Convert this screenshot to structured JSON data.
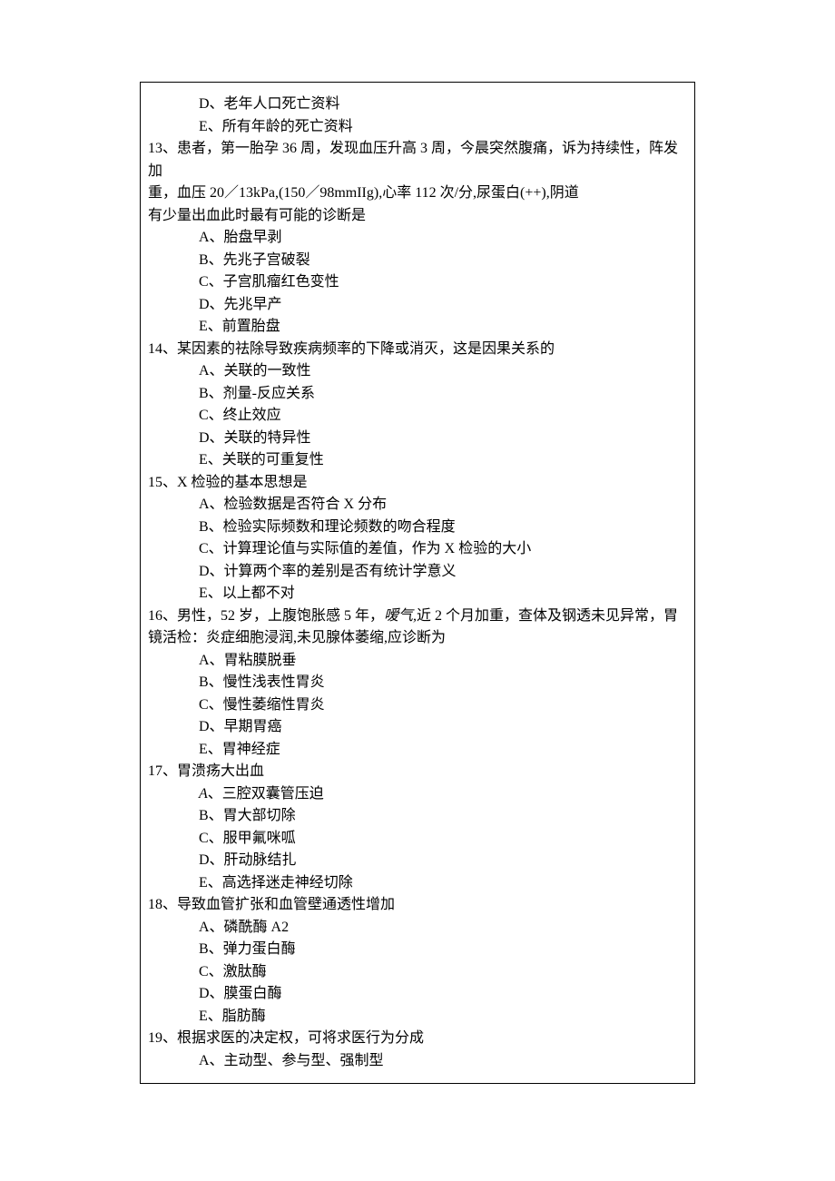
{
  "orphanOptions": [
    "D、老年人口死亡资料",
    "E、所有年龄的死亡资料"
  ],
  "q13": {
    "stemLines": [
      "13、患者，第一胎孕 36 周，发现血压升高 3 周，今晨突然腹痛，诉为持续性，阵发加",
      "重，血压 20／13kPa,(150／98mmIIg),心率 112 次/分,尿蛋白(++),阴道",
      "有少量出血此时最有可能的诊断是"
    ],
    "options": [
      "A、胎盘早剥",
      "B、先兆子宫破裂",
      "C、子宫肌瘤红色变性",
      "D、先兆早产",
      "E、前置胎盘"
    ]
  },
  "q14": {
    "stem": "14、某因素的祛除导致疾病频率的下降或消灭，这是因果关系的",
    "options": [
      "A、关联的一致性",
      "B、剂量-反应关系",
      "C、终止效应",
      "D、关联的特异性",
      "E、关联的可重复性"
    ]
  },
  "q15": {
    "stem": "15、X 检验的基本思想是",
    "options": [
      "A、检验数据是否符合 X 分布",
      "B、检验实际频数和理论频数的吻合程度",
      "C、计算理论值与实际值的差值，作为 X 检验的大小",
      "D、计算两个率的差别是否有统计学意义",
      "E、以上都不对"
    ]
  },
  "q16": {
    "stemParts": {
      "p1": "16、男性，52 岁，上腹饱胀感 5 年，",
      "p2": "嗳气,",
      "p3": "近 2 个月加重，查体及钢透未见异常，胃",
      "p4": "镜活检：炎症细胞浸润,未见腺体萎缩,应诊断为"
    },
    "options": [
      "A、胃粘膜脱垂",
      "B、慢性浅表性胃炎",
      "C、慢性萎缩性胃炎",
      "D、早期胃癌",
      "E、胃神经症"
    ]
  },
  "q17": {
    "stem": "17、胃溃疡大出血",
    "aPrefix": "A",
    "aRest": "、三腔双囊管压迫",
    "options": [
      "B、胃大部切除",
      "C、服甲氟咪呱",
      "D、肝动脉结扎",
      "E、高选择迷走神经切除"
    ]
  },
  "q18": {
    "stem": "18、导致血管扩张和血管壁通透性增加",
    "options": [
      "A、磷酰酶 A2",
      "B、弹力蛋白酶",
      "C、激肽酶",
      "D、膜蛋白酶",
      "E、脂肪酶"
    ]
  },
  "q19": {
    "stem": "19、根据求医的决定权，可将求医行为分成",
    "options": [
      "A、主动型、参与型、强制型"
    ]
  }
}
